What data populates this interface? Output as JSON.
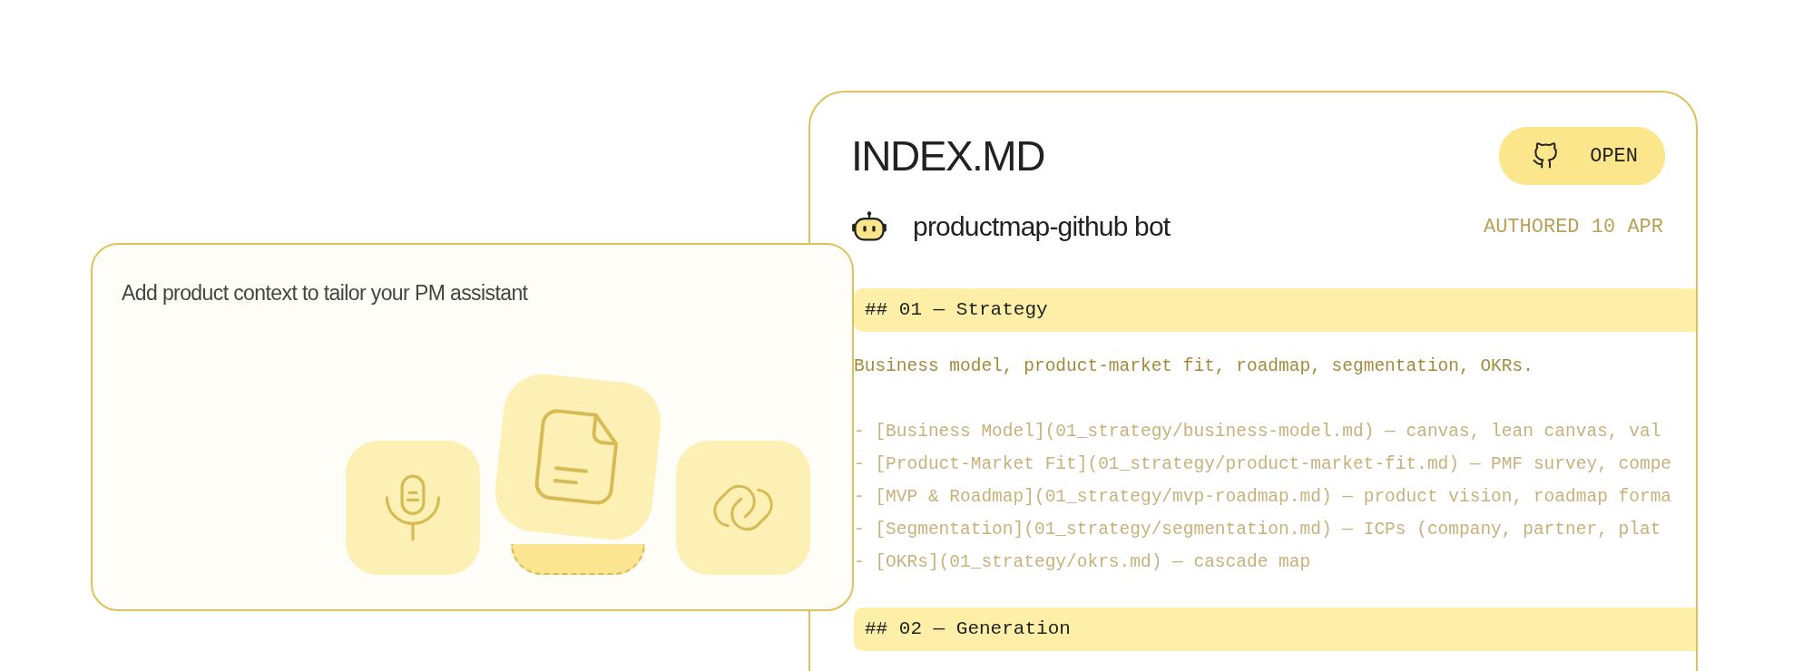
{
  "intro_card": {
    "prompt": "Add product context to tailor your PM assistant"
  },
  "file_card": {
    "title": "INDEX.MD",
    "open_button": {
      "label": "OPEN"
    },
    "author": "productmap-github bot",
    "authored": "AUTHORED 10 APR",
    "sections": [
      {
        "heading": "## 01 — Strategy",
        "description": "Business model, product-market fit, roadmap, segmentation, OKRs.",
        "links": [
          "- [Business Model](01_strategy/business-model.md) — canvas, lean canvas, val",
          "- [Product-Market Fit](01_strategy/product-market-fit.md) — PMF survey, compe",
          "- [MVP & Roadmap](01_strategy/mvp-roadmap.md) — product vision, roadmap forma",
          "- [Segmentation](01_strategy/segmentation.md) — ICPs (company, partner, plat",
          "- [OKRs](01_strategy/okrs.md) — cascade map"
        ]
      },
      {
        "heading": "## 02 — Generation"
      }
    ]
  }
}
